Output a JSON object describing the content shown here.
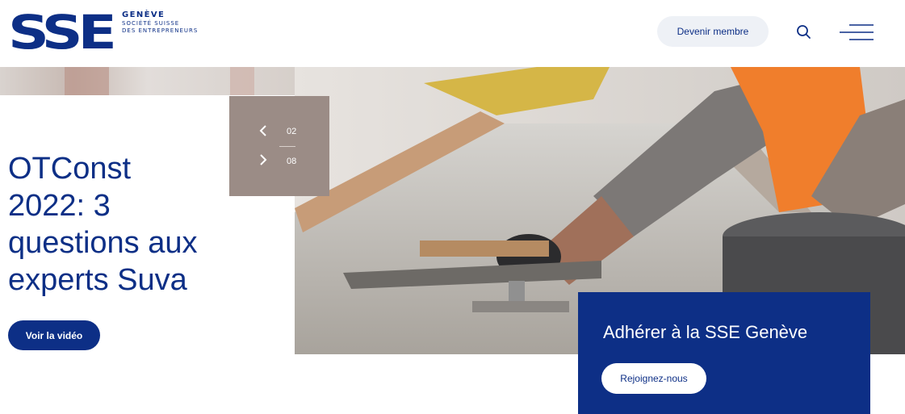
{
  "brand": {
    "mark": "SSE",
    "line1": "GENÈVE",
    "line2": "SOCIÉTÉ SUISSE",
    "line3": "DES ENTREPRENEURS"
  },
  "header": {
    "member_button": "Devenir membre",
    "search_icon": "search-icon",
    "menu_icon": "hamburger-menu-icon"
  },
  "hero": {
    "title_lines": [
      "OTConst",
      "2022: 3",
      "questions aux",
      "experts Suva"
    ],
    "cta_label": "Voir la vidéo",
    "slider": {
      "current": "02",
      "total": "08"
    }
  },
  "join": {
    "title": "Adhérer à la SSE Genève",
    "button": "Rejoignez-nous"
  },
  "colors": {
    "brand_blue": "#0d2f86",
    "slider_bg": "#9b8c86",
    "pill_bg": "#eef1f6"
  }
}
